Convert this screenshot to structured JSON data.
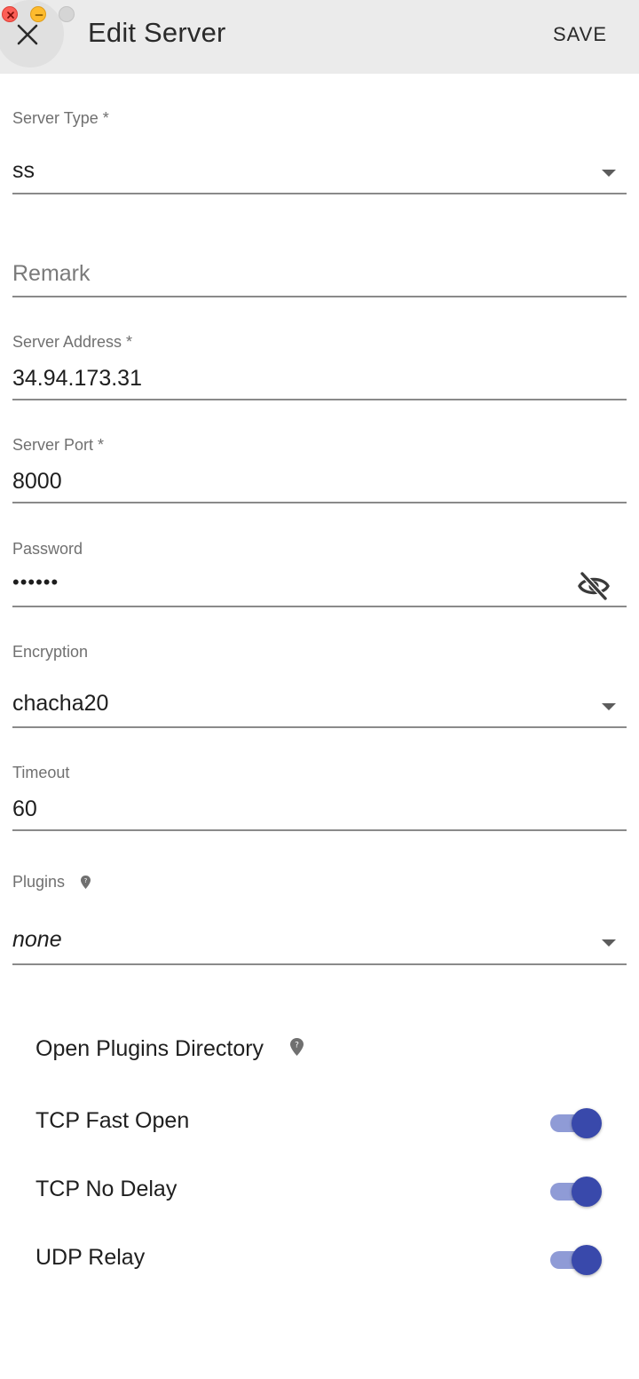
{
  "header": {
    "title": "Edit Server",
    "save_label": "SAVE"
  },
  "form": {
    "server_type": {
      "label": "Server Type *",
      "value": "ss"
    },
    "remark": {
      "placeholder": "Remark",
      "value": ""
    },
    "server_address": {
      "label": "Server Address *",
      "value": "34.94.173.31"
    },
    "server_port": {
      "label": "Server Port *",
      "value": "8000"
    },
    "password": {
      "label": "Password",
      "value": "••••••"
    },
    "encryption": {
      "label": "Encryption",
      "value": "chacha20"
    },
    "timeout": {
      "label": "Timeout",
      "value": "60"
    },
    "plugins": {
      "label": "Plugins",
      "value": "none"
    }
  },
  "options": {
    "open_plugins_directory": "Open Plugins Directory",
    "tcp_fast_open": {
      "label": "TCP Fast Open",
      "enabled": true
    },
    "tcp_no_delay": {
      "label": "TCP No Delay",
      "enabled": true
    },
    "udp_relay": {
      "label": "UDP Relay",
      "enabled": true
    }
  },
  "colors": {
    "accent": "#3949ab",
    "accent_track": "#8f9bd6",
    "titlebar": "#ebebeb"
  },
  "icons": {
    "close": "close-icon",
    "password_visibility": "eye-off-icon",
    "plugins_help": "help-bubble-icon",
    "dropdown": "chevron-down-icon"
  }
}
